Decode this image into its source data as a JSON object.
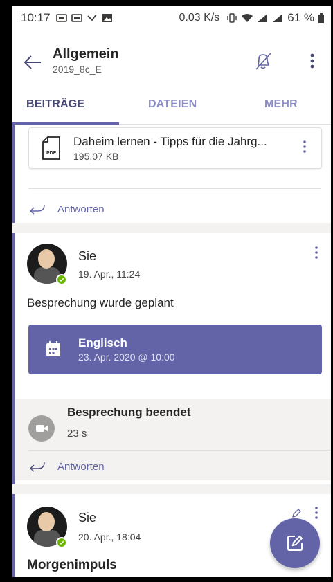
{
  "status_bar": {
    "time": "10:17",
    "speed": "0.03 K/s",
    "battery": "61 %"
  },
  "header": {
    "title": "Allgemein",
    "subtitle": "2019_8c_E"
  },
  "tabs": [
    {
      "label": "BEITRÄGE",
      "active": true
    },
    {
      "label": "DATEIEN",
      "active": false
    },
    {
      "label": "MEHR",
      "active": false
    }
  ],
  "post1": {
    "attachment": {
      "name": "Daheim lernen - Tipps für die Jahrg...",
      "size": "195,07 KB",
      "icon": "pdf-file-icon"
    },
    "reply_label": "Antworten"
  },
  "post2": {
    "author": "Sie",
    "timestamp": "19. Apr., 11:24",
    "message": "Besprechung wurde geplant",
    "meeting": {
      "title": "Englisch",
      "date": "23. Apr. 2020 @ 10:00"
    },
    "ended": {
      "title": "Besprechung beendet",
      "duration": "23 s"
    },
    "reply_label": "Antworten"
  },
  "post3": {
    "author": "Sie",
    "timestamp": "20. Apr., 18:04",
    "message": "Morgenimpuls"
  },
  "colors": {
    "accent": "#6264a7",
    "tab_inactive": "#8b8cc7",
    "presence": "#6bb700"
  }
}
